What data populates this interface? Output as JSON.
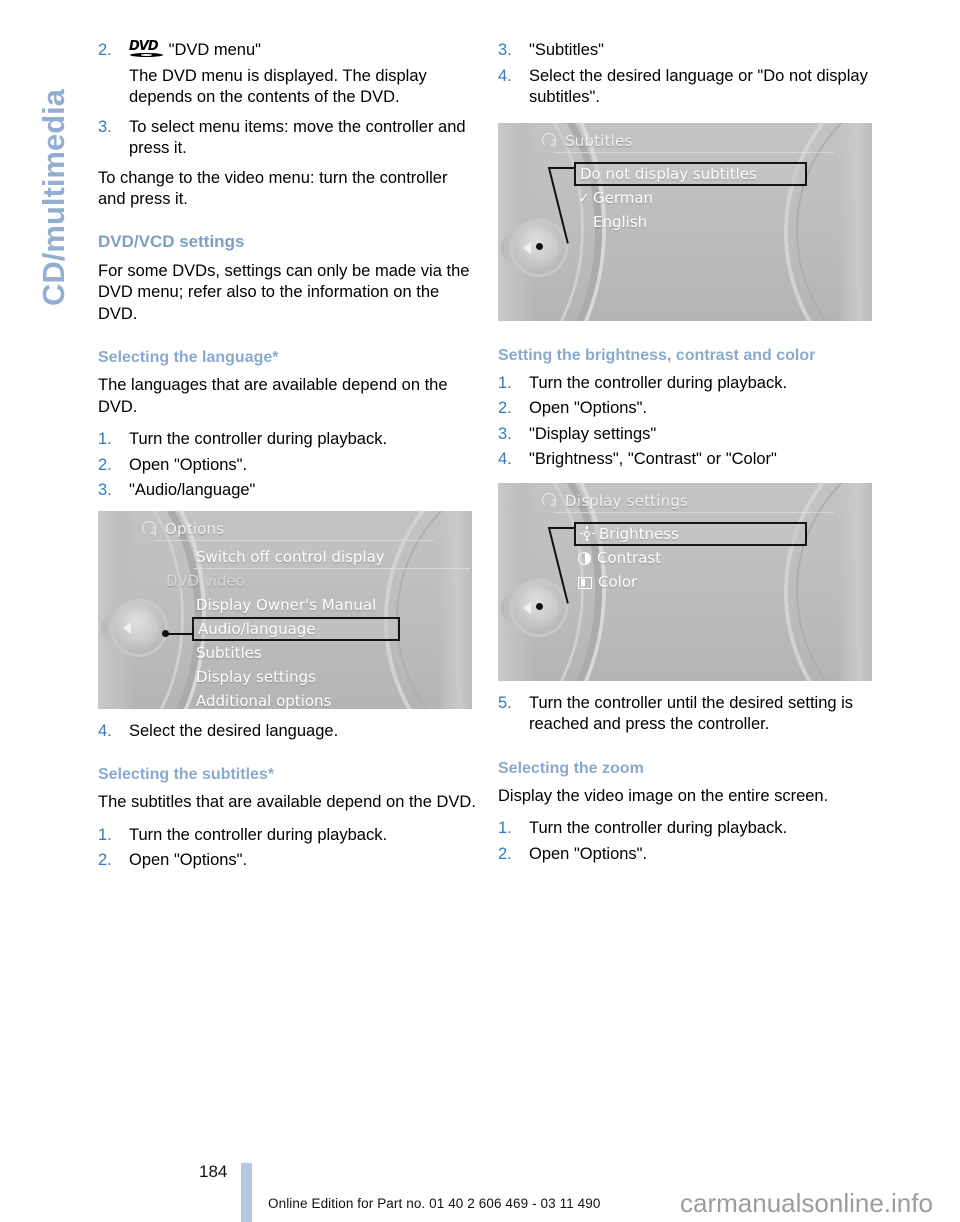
{
  "chapter": {
    "label": "CD/multimedia"
  },
  "left_column": {
    "step2": {
      "num": "2.",
      "icon": "dvd-logo-icon",
      "text": "\"DVD menu\"",
      "detail": "The DVD menu is displayed. The display depends on the contents of the DVD."
    },
    "step3": {
      "num": "3.",
      "text": "To select menu items: move the controller and press it."
    },
    "para_video_menu": "To change to the video menu: turn the controller and press it.",
    "heading_settings": "DVD/VCD settings",
    "para_settings": "For some DVDs, settings can only be made via the DVD menu; refer also to the information on the DVD.",
    "heading_language": "Selecting the language*",
    "para_language": "The languages that are available depend on the DVD.",
    "lang_steps": [
      {
        "num": "1.",
        "text": "Turn the controller during playback."
      },
      {
        "num": "2.",
        "text": "Open \"Options\"."
      },
      {
        "num": "3.",
        "text": "\"Audio/language\""
      }
    ],
    "step4_language": {
      "num": "4.",
      "text": "Select the desired language."
    },
    "heading_subtitles": "Selecting the subtitles*",
    "para_subtitles": "The subtitles that are available depend on the DVD.",
    "subtitle_steps": [
      {
        "num": "1.",
        "text": "Turn the controller during playback."
      },
      {
        "num": "2.",
        "text": "Open \"Options\"."
      }
    ]
  },
  "right_column": {
    "subtitle_steps_cont": [
      {
        "num": "3.",
        "text": "\"Subtitles\""
      },
      {
        "num": "4.",
        "text": "Select the desired language or \"Do not display subtitles\"."
      }
    ],
    "heading_brightness": "Setting the brightness, contrast and color",
    "brightness_steps": [
      {
        "num": "1.",
        "text": "Turn the controller during playback."
      },
      {
        "num": "2.",
        "text": "Open \"Options\"."
      },
      {
        "num": "3.",
        "text": "\"Display settings\""
      },
      {
        "num": "4.",
        "text": "\"Brightness\", \"Contrast\" or \"Color\""
      }
    ],
    "step5_brightness": {
      "num": "5.",
      "text": "Turn the controller until the desired setting is reached and press the controller."
    },
    "heading_zoom": "Selecting the zoom",
    "para_zoom": "Display the video image on the entire screen.",
    "zoom_steps": [
      {
        "num": "1.",
        "text": "Turn the controller during playback."
      },
      {
        "num": "2.",
        "text": "Open \"Options\"."
      }
    ]
  },
  "screens": {
    "options": {
      "title": "Options",
      "icon": "cd-note-icon",
      "items": [
        {
          "label": "Switch off control display",
          "state": "normal"
        },
        {
          "label": "DVD video",
          "state": "dim"
        },
        {
          "label": "Display Owner's Manual",
          "state": "normal"
        },
        {
          "label": "Audio/language",
          "state": "selected"
        },
        {
          "label": "Subtitles",
          "state": "normal"
        },
        {
          "label": "Display settings",
          "state": "normal"
        },
        {
          "label": "Additional options",
          "state": "normal"
        }
      ]
    },
    "subtitles": {
      "title": "Subtitles",
      "icon": "cd-note-icon",
      "items": [
        {
          "label": "Do not display subtitles",
          "state": "selected",
          "check": false
        },
        {
          "label": "German",
          "state": "normal",
          "check": true
        },
        {
          "label": "English",
          "state": "normal",
          "check": false
        }
      ]
    },
    "display_settings": {
      "title": "Display settings",
      "icon": "cd-note-icon",
      "items": [
        {
          "label": "Brightness",
          "state": "selected",
          "glyph": "sun-icon"
        },
        {
          "label": "Contrast",
          "state": "normal",
          "glyph": "contrast-icon"
        },
        {
          "label": "Color",
          "state": "normal",
          "glyph": "color-icon"
        }
      ]
    }
  },
  "footer": {
    "page_number": "184",
    "edition_text": "Online Edition for Part no. 01 40 2 606 469 - 03 11 490",
    "watermark": "carmanualsonline.info"
  },
  "colors": {
    "heading_blue": "#7e9fc6",
    "step_number_blue": "#2f7ac0",
    "tab_blue": "#93aed0",
    "footer_bar_blue": "#b5c7e0"
  }
}
